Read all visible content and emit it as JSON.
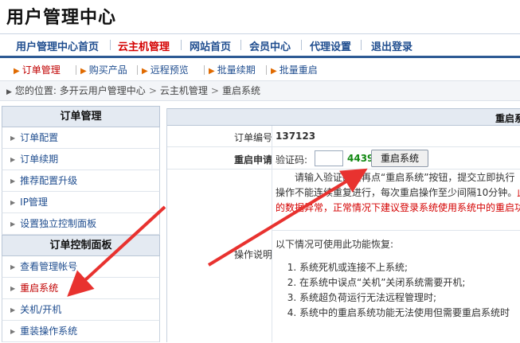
{
  "site": {
    "title": "用户管理中心"
  },
  "nav_main": [
    "用户管理中心首页",
    "云主机管理",
    "网站首页",
    "会员中心",
    "代理设置",
    "退出登录"
  ],
  "nav_sub": [
    "订单管理",
    "购买产品",
    "远程预览",
    "批量续期",
    "批量重启"
  ],
  "breadcrumb": {
    "label": "您的位置:",
    "items": [
      "多开云用户管理中心",
      "云主机管理",
      "重启系统"
    ]
  },
  "sidebar": {
    "section1": {
      "title": "订单管理",
      "items": [
        "订单配置",
        "订单续期",
        "推荐配置升级",
        "IP管理",
        "设置独立控制面板"
      ]
    },
    "section2": {
      "title": "订单控制面板",
      "items": [
        "查看管理帐号",
        "重启系统",
        "关机/开机",
        "重装操作系统"
      ]
    }
  },
  "main": {
    "header": "重启系",
    "order_label": "订单编号",
    "order_value": "137123",
    "restart_label": "重启申请",
    "captcha_label": "验证码:",
    "captcha_value": "",
    "captcha_code": "4439",
    "restart_button": "重启系统",
    "desc_label": "操作说明",
    "desc_line1": "请输入验证码后再点“重启系统”按钮，提交立即执行",
    "desc_line2a": "操作不能连续重复进行，每次重启操作至少间隔10分钟。",
    "desc_line2b": "此",
    "desc_line3": "的数据异常，正常情况下建议登录系统使用系统中的重启功",
    "list_intro": "以下情况可使用此功能恢复:",
    "list": [
      "系统死机或连接不上系统;",
      "在系统中误点“关机”关闭系统需要开机;",
      "系统超负荷运行无法远程管理时;",
      "系统中的重启系统功能无法使用但需要重启系统时"
    ]
  },
  "colors": {
    "accent_blue": "#1f4d8f",
    "active_red": "#d40000",
    "arrow_red": "#e8322f",
    "code_green": "#118811"
  }
}
